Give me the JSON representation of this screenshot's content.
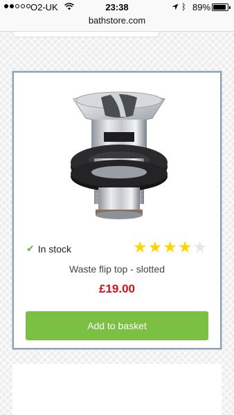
{
  "status_bar": {
    "carrier": "O2-UK",
    "time": "23:38",
    "battery": "89%",
    "battery_level": 0.89,
    "signal_bars_filled": 2,
    "signal_bars_total": 5,
    "icons": [
      "wifi-icon",
      "location-icon",
      "bluetooth-icon",
      "battery-icon"
    ]
  },
  "browser": {
    "url": "bathstore.com"
  },
  "product": {
    "stock_status": "In stock",
    "rating": 4,
    "rating_max": 5,
    "name": "Waste flip top - slotted",
    "price": "£19.00",
    "button_label": "Add to basket"
  },
  "colors": {
    "accent_green": "#7cc043",
    "price_red": "#d0121a",
    "star_yellow": "#ffd500",
    "check_green": "#6ab23a"
  }
}
